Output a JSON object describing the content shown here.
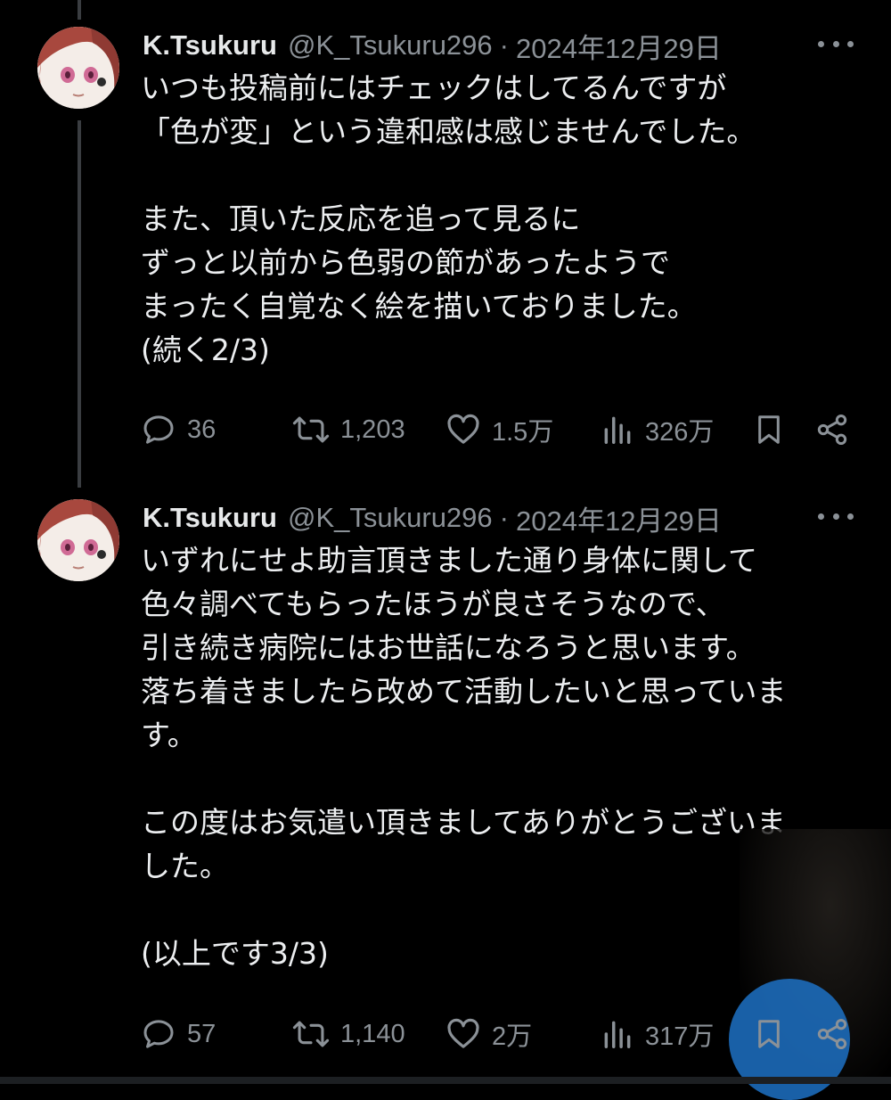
{
  "tweets": [
    {
      "author": {
        "name": "K.Tsukuru",
        "handle": "@K_Tsukuru296",
        "separator": "·",
        "date": "2024年12月29日"
      },
      "paragraphs": [
        "いつも投稿前にはチェックはしてるんですが\n「色が変」という違和感は感じませんでした。",
        "また、頂いた反応を追って見るに\nずっと以前から色弱の節があったようで\nまったく自覚なく絵を描いておりました。\n(続く2/3)"
      ],
      "stats": {
        "replies": "36",
        "reposts": "1,203",
        "likes": "1.5万",
        "views": "326万"
      }
    },
    {
      "author": {
        "name": "K.Tsukuru",
        "handle": "@K_Tsukuru296",
        "separator": "·",
        "date": "2024年12月29日"
      },
      "paragraphs": [
        "いずれにせよ助言頂きました通り身体に関して\n色々調べてもらったほうが良さそうなので、\n引き続き病院にはお世話になろうと思います。\n落ち着きましたら改めて活動したいと思っていま\nす。",
        "この度はお気遣い頂きましてありがとうございま\nした。",
        "(以上です3/3)"
      ],
      "stats": {
        "replies": "57",
        "reposts": "1,140",
        "likes": "2万",
        "views": "317万"
      }
    }
  ],
  "icons": {
    "more": "more-icon",
    "reply": "reply-icon",
    "repost": "repost-icon",
    "like": "heart-icon",
    "views": "views-icon",
    "bookmark": "bookmark-icon",
    "share": "share-icon"
  },
  "colors": {
    "background": "#000000",
    "text": "#e7e9ea",
    "secondary": "#8b9197",
    "thread_line": "#3a3d41",
    "badge_blue": "#1d71c4"
  }
}
